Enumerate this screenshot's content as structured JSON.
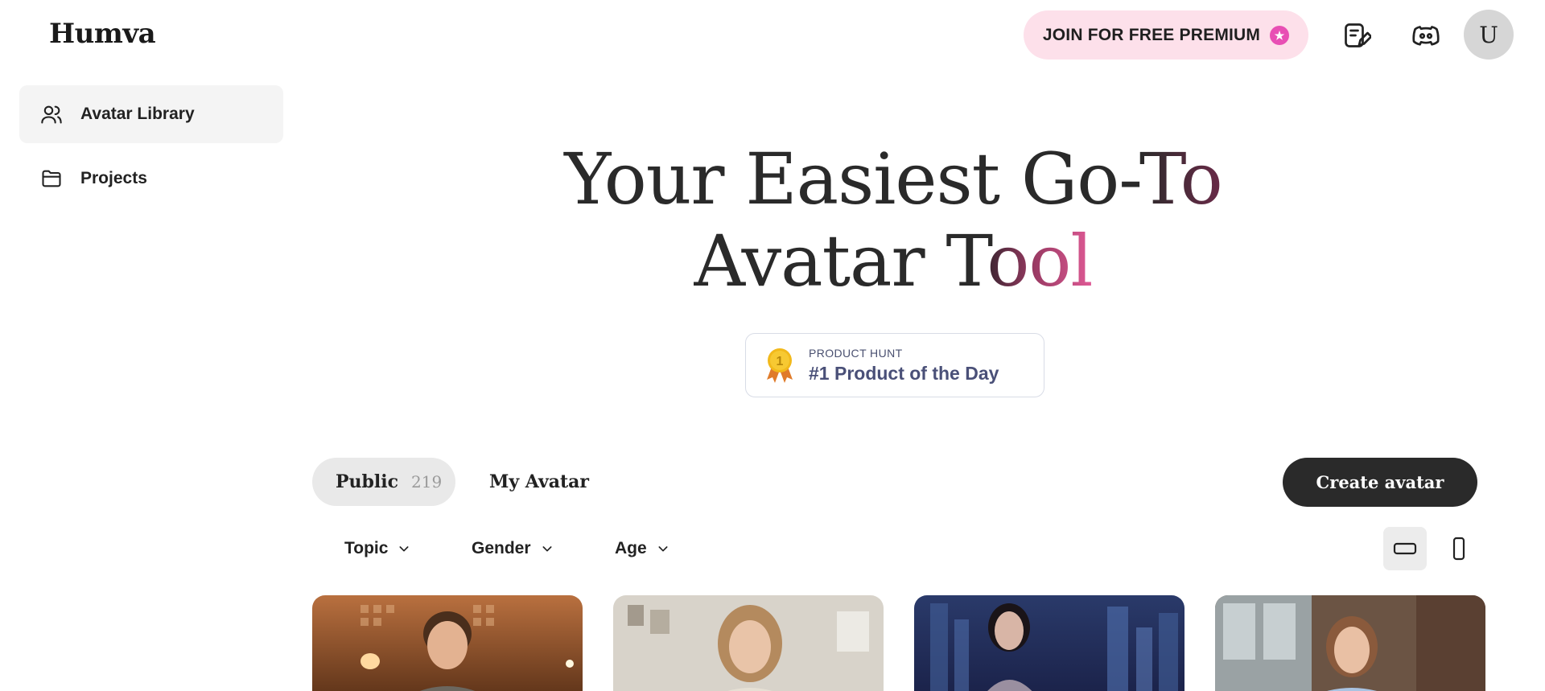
{
  "header": {
    "logo": "Humva",
    "premium_label": "JOIN FOR FREE PREMIUM",
    "avatar_initial": "U"
  },
  "sidebar": {
    "items": [
      {
        "label": "Avatar Library",
        "icon": "users-icon",
        "active": true
      },
      {
        "label": "Projects",
        "icon": "folder-icon",
        "active": false
      }
    ]
  },
  "hero": {
    "line1_plain": "Your Easiest Go-",
    "line1_grad": "To",
    "line2_plain": "Avatar T",
    "line2_grad": "ool"
  },
  "badge": {
    "small": "PRODUCT HUNT",
    "big": "#1 Product of the Day",
    "medal_number": "1"
  },
  "tabs": {
    "public_label": "Public",
    "public_count": "219",
    "mine_label": "My Avatar"
  },
  "create_label": "Create avatar",
  "filters": [
    {
      "label": "Topic"
    },
    {
      "label": "Gender"
    },
    {
      "label": "Age"
    }
  ],
  "colors": {
    "accent_pink": "#e05a96",
    "premium_bg": "#fde0ea",
    "dark": "#2a2a2a"
  }
}
